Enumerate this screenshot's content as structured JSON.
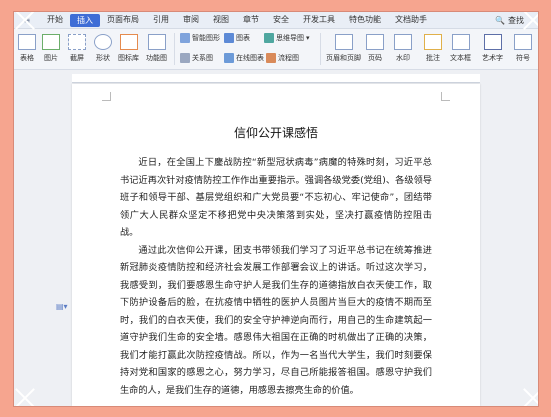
{
  "menubar": {
    "items": [
      "开始",
      "插入",
      "页面布局",
      "引用",
      "审阅",
      "视图",
      "章节",
      "安全",
      "开发工具",
      "特色功能",
      "文档助手"
    ],
    "active_index": 1,
    "search_label": "查找"
  },
  "ribbon": {
    "top": [
      "智能图形",
      "图表",
      "思维导图",
      "页眉和页脚",
      "页码",
      "水印",
      "批注",
      "文本框",
      "艺术字",
      "符号"
    ],
    "bottom": [
      "表格",
      "图片",
      "截屏",
      "形状",
      "图标库",
      "功能图",
      "关系图",
      "在线图表",
      "流程图"
    ]
  },
  "document": {
    "title": "信仰公开课感悟",
    "paragraphs": [
      "近日，在全国上下鏖战防控“新型冠状病毒”病魔的特殊时刻，习近平总书记近再次针对疫情防控工作作出重要指示。强调各级党委(党组)、各级领导班子和领导干部、基层党组织和广大党员要“不忘初心、牢记使命”，团结带领广大人民群众坚定不移把党中央决策落到实处，坚决打赢疫情防控阻击战。",
      "通过此次信仰公开课，团支书带领我们学习了习近平总书记在统筹推进新冠肺炎疫情防控和经济社会发展工作部署会议上的讲话。听过这次学习，我感受到，我们要感恩生命守护人是我们生存的道德指放白衣天使工作，取下防护设备后的脸，在抗疫情中牺牲的医护人员图片当巨大的疫情不期而至时，我们的白衣天使，我们的安全守护神逆向而行，用自己的生命建筑起一道守护我们生命的安全墙。感恩伟大祖国在正确的时机做出了正确的决策，我们才能打赢此次防控疫情战。所以，作为一名当代大学生，我们时刻要保持对党和国家的感恩之心，努力学习，尽自己所能报答祖国。感恩守护我们生命的人，是我们生存的道德，用感恩去擦亮生命的价值。"
    ]
  },
  "colors": {
    "background": "#f6a58f",
    "accent": "#3e6dd6"
  }
}
